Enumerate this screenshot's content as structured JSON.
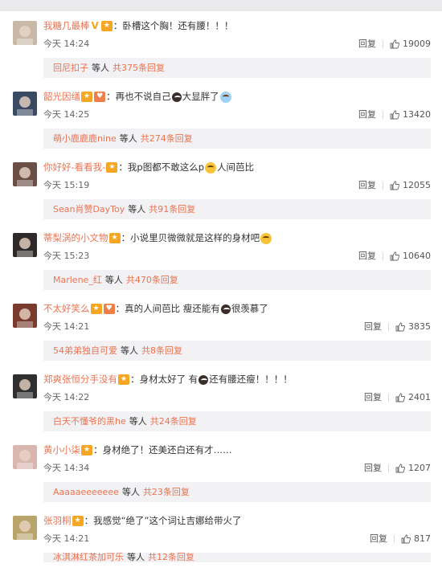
{
  "comments": [
    {
      "user": "我糖几最棒",
      "badges": [
        "v",
        "vip"
      ],
      "text": "卧槽这个胸！还有腰！！！",
      "emojis": [],
      "time": "今天 14:24",
      "reply": "回复",
      "likes": "19009",
      "sub_user": "回尼扣子",
      "sub_mid": "等人",
      "sub_more": "共375条回复",
      "avatar_color": "#c8b9a6"
    },
    {
      "user": "韶光因缮",
      "badges": [
        "vip",
        "fan"
      ],
      "text": "再也不说自己",
      "text2": "大显胖了",
      "emojis": [
        "bear",
        "sweat"
      ],
      "time": "今天 14:25",
      "reply": "回复",
      "likes": "13420",
      "sub_user": "萌小鹿鹿鹿nine",
      "sub_mid": "等人",
      "sub_more": "共274条回复",
      "avatar_color": "#3b4a63"
    },
    {
      "user": "你好好-看看我-",
      "badges": [
        "vip"
      ],
      "text": "我p图都不敢这么p",
      "text2": "人间芭比",
      "emojis": [
        "smile"
      ],
      "time": "今天 15:19",
      "reply": "回复",
      "likes": "12055",
      "sub_user": "Sean肖赞DayToy",
      "sub_mid": "等人",
      "sub_more": "共91条回复",
      "avatar_color": "#6b4f46"
    },
    {
      "user": "蒂梨涡的小文物",
      "badges": [
        "vip"
      ],
      "text": "小说里贝微微就是这样的身材吧",
      "emojis": [
        "wow"
      ],
      "time": "今天 15:23",
      "reply": "回复",
      "likes": "10640",
      "sub_user": "Marlene_红",
      "sub_mid": "等人",
      "sub_more": "共470条回复",
      "avatar_color": "#2e2a2a"
    },
    {
      "user": "不太好笑么",
      "badges": [
        "vip",
        "fan"
      ],
      "text": "真的人间芭比 瘦还能有",
      "text2": "很羡慕了",
      "emojis": [
        "bear"
      ],
      "time": "今天 14:21",
      "reply": "回复",
      "likes": "3835",
      "sub_user": "54弟弟独自可爱",
      "sub_mid": "等人",
      "sub_more": "共8条回复",
      "avatar_color": "#7a3b2e"
    },
    {
      "user": "郑爽张恒分手没有",
      "badges": [
        "vip"
      ],
      "text": "身材太好了 有",
      "text2": "还有腰还瘦！！！！",
      "emojis": [
        "bear"
      ],
      "time": "今天 14:22",
      "reply": "回复",
      "likes": "2401",
      "sub_user": "白天不懂爷的黑he",
      "sub_mid": "等人",
      "sub_more": "共24条回复",
      "avatar_color": "#2f2f2f"
    },
    {
      "user": "黄小小柒",
      "badges": [
        "vip"
      ],
      "text": "身材绝了！还美还白还有才……",
      "emojis": [],
      "time": "今天 14:34",
      "reply": "回复",
      "likes": "1207",
      "sub_user": "Aaaaaeeeeeee",
      "sub_mid": "等人",
      "sub_more": "共23条回复",
      "avatar_color": "#d9b6b0"
    },
    {
      "user": "张羽桐",
      "badges": [
        "vip"
      ],
      "text": "我感觉“绝了”这个词让吉娜给带火了",
      "emojis": [],
      "time": "今天 14:21",
      "reply": "回复",
      "likes": "817",
      "sub_user": "冰淇淋红茶加可乐",
      "sub_mid": "等人",
      "sub_more": "共12条回复",
      "avatar_color": "#b9a46a"
    }
  ]
}
